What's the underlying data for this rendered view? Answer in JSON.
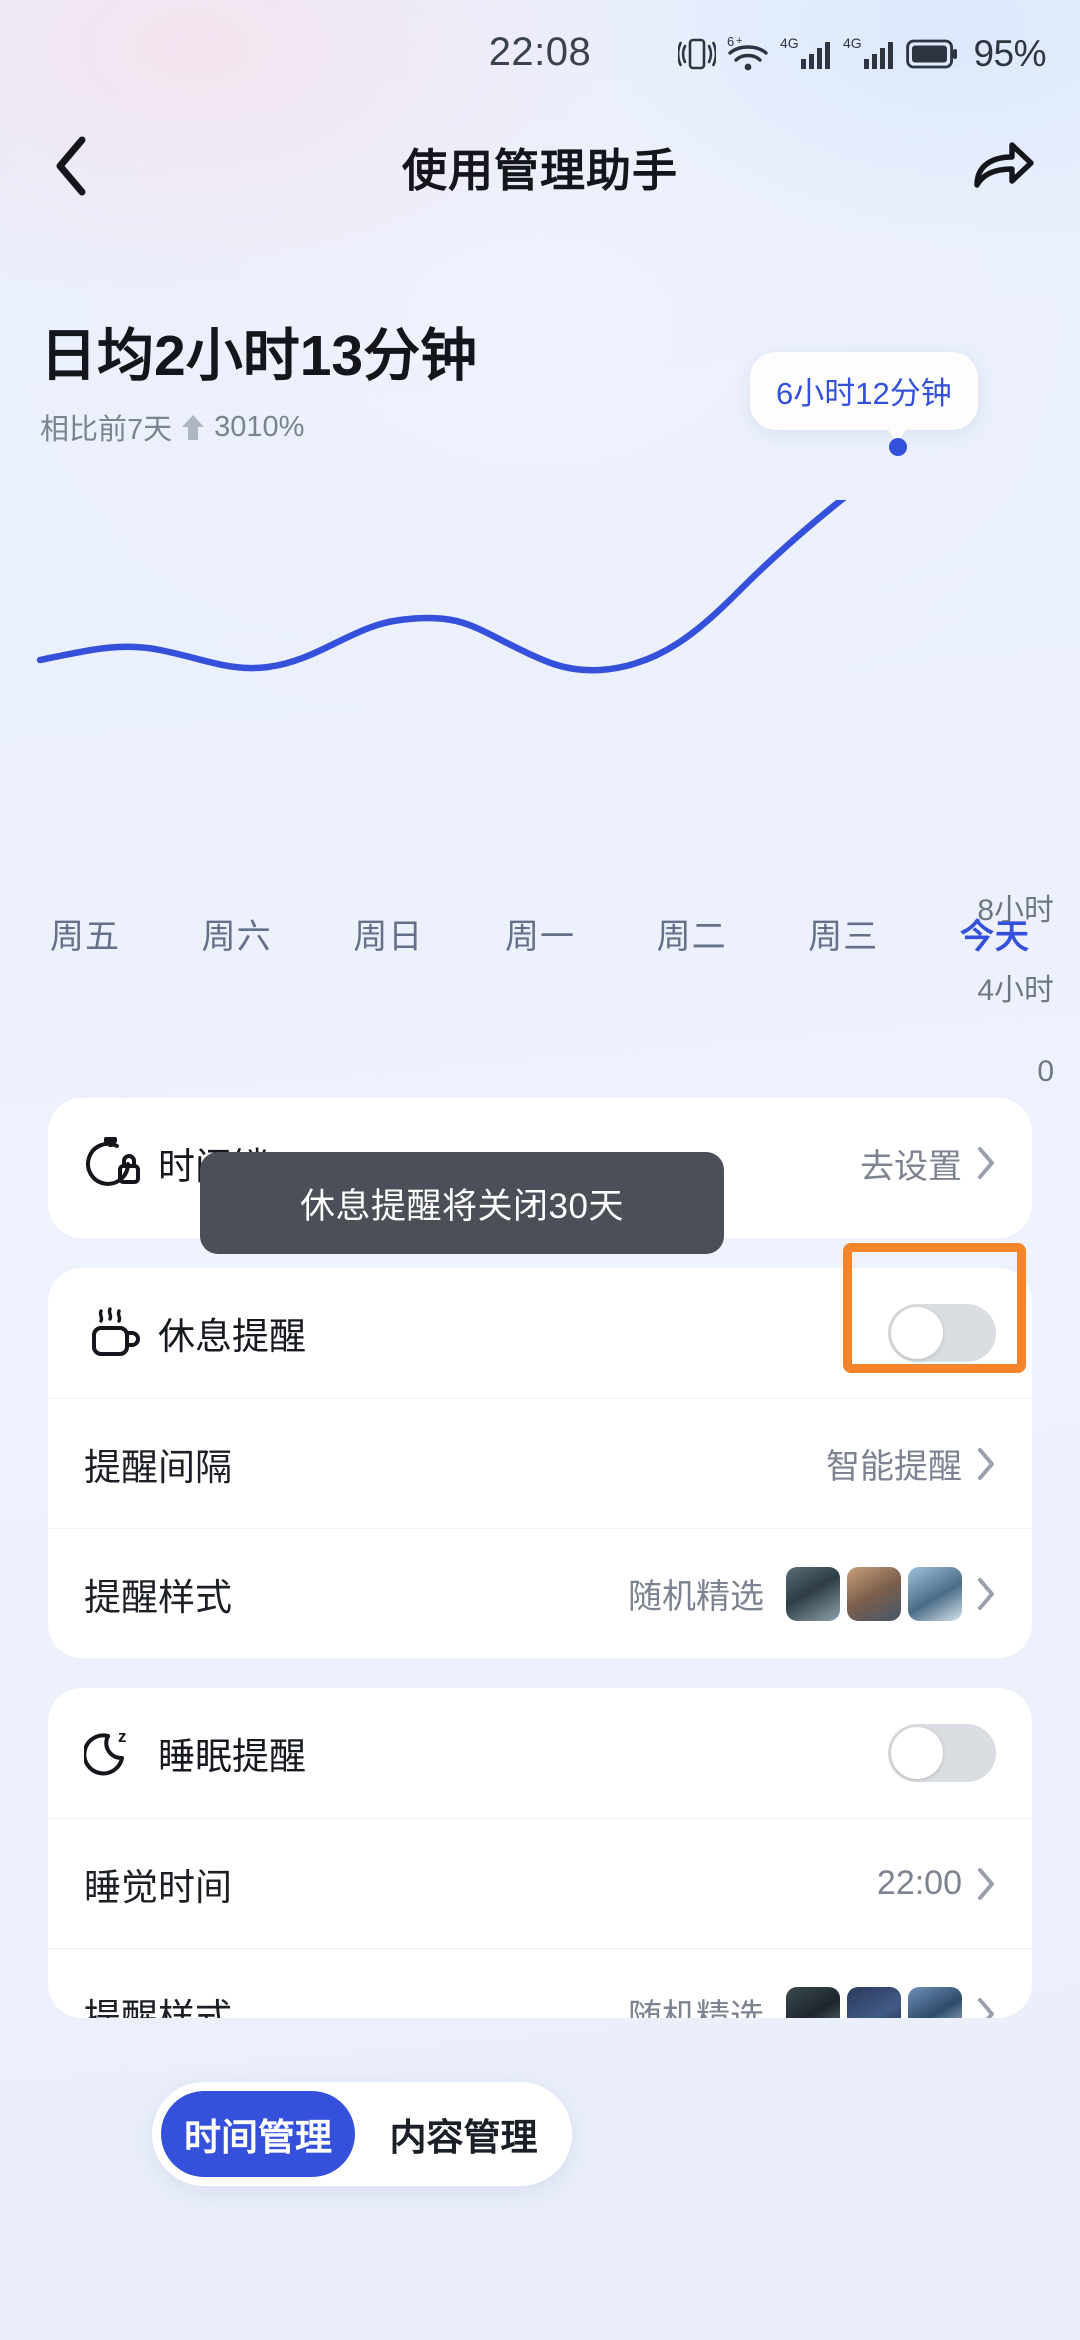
{
  "statusbar": {
    "time": "22:08",
    "battery_percent": "95%",
    "icons": [
      "vibrate-icon",
      "wifi6-icon",
      "signal-4g-icon",
      "signal-4g-icon",
      "battery-icon"
    ]
  },
  "navbar": {
    "back_icon": "chevron-left-icon",
    "title": "使用管理助手",
    "share_icon": "share-arrow-icon"
  },
  "summary": {
    "headline": "日均2小时13分钟",
    "compare_label": "相比前7天",
    "trend_icon": "arrow-up-icon",
    "change_percent": "3010%"
  },
  "chart_data": {
    "type": "line",
    "title": "",
    "categories": [
      "周五",
      "周六",
      "周日",
      "周一",
      "周二",
      "周三",
      "今天"
    ],
    "values": [
      1.0,
      0.7,
      1.5,
      2.2,
      1.6,
      1.2,
      6.2
    ],
    "value_labels": [
      "",
      "",
      "",
      "",
      "",
      "",
      "6小时12分钟"
    ],
    "highlight_index": 6,
    "tooltip": "6小时12分钟",
    "ylabel": "",
    "xlabel": "",
    "ylim": [
      0,
      8
    ],
    "yticks": [
      "0",
      "4小时",
      "8小时"
    ],
    "ytick_values": [
      0,
      4,
      8
    ],
    "grid": false,
    "legend": "none",
    "line_color": "#3550db",
    "point_color": "#3550db"
  },
  "weekdays": {
    "items": [
      {
        "label": "周五",
        "active": false
      },
      {
        "label": "周六",
        "active": false
      },
      {
        "label": "周日",
        "active": false
      },
      {
        "label": "周一",
        "active": false
      },
      {
        "label": "周二",
        "active": false
      },
      {
        "label": "周三",
        "active": false
      },
      {
        "label": "今天",
        "active": true
      }
    ]
  },
  "cards": {
    "timelock": {
      "icon": "stopwatch-lock-icon",
      "label": "时间锁",
      "action": "去设置",
      "chevron": "chevron-right-icon"
    },
    "break_reminder": {
      "icon": "coffee-cup-icon",
      "label": "休息提醒",
      "toggle_state": "off",
      "interval": {
        "label": "提醒间隔",
        "value": "智能提醒",
        "chevron": "chevron-right-icon"
      },
      "style": {
        "label": "提醒样式",
        "value": "随机精选",
        "chevron": "chevron-right-icon"
      }
    },
    "sleep_reminder": {
      "icon": "moon-z-icon",
      "label": "睡眠提醒",
      "toggle_state": "off",
      "bedtime": {
        "label": "睡觉时间",
        "value": "22:00",
        "chevron": "chevron-right-icon"
      },
      "style": {
        "label": "提醒样式",
        "value": "随机精选",
        "chevron": "chevron-right-icon"
      }
    }
  },
  "toast": {
    "message": "休息提醒将关闭30天"
  },
  "annotation": {
    "color": "#f5842a",
    "target": "break-reminder-toggle"
  },
  "tabbar": {
    "tabs": [
      {
        "label": "时间管理",
        "active": true
      },
      {
        "label": "内容管理",
        "active": false
      }
    ],
    "active_color": "#3550db"
  }
}
